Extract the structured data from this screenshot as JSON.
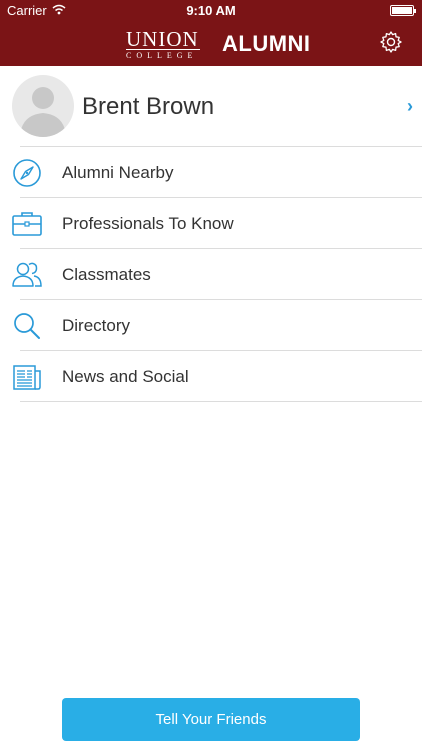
{
  "status_bar": {
    "carrier": "Carrier",
    "time": "9:10 AM"
  },
  "header": {
    "logo_union": "UNION",
    "logo_college": "COLLEGE",
    "title": "ALUMNI"
  },
  "profile": {
    "name": "Brent Brown"
  },
  "menu": {
    "items": [
      {
        "label": "Alumni Nearby",
        "icon": "compass-icon"
      },
      {
        "label": "Professionals To Know",
        "icon": "briefcase-icon"
      },
      {
        "label": "Classmates",
        "icon": "people-icon"
      },
      {
        "label": "Directory",
        "icon": "search-icon"
      },
      {
        "label": "News and Social",
        "icon": "newspaper-icon"
      }
    ]
  },
  "cta": {
    "label": "Tell Your Friends"
  },
  "colors": {
    "brand": "#7b1416",
    "accent": "#29aee6",
    "icon": "#2a9ad8"
  }
}
